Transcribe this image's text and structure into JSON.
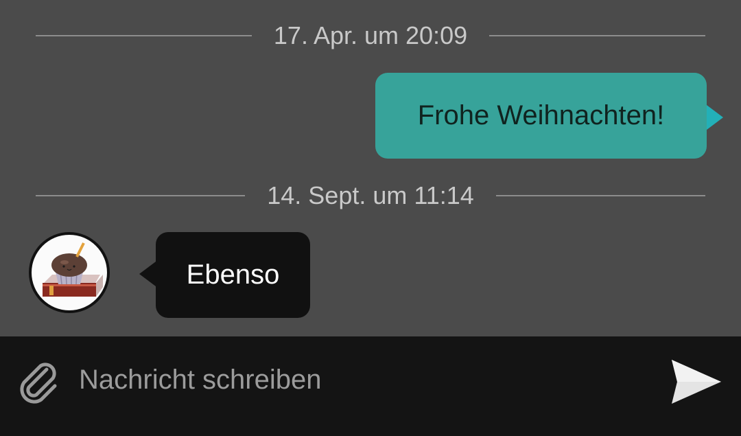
{
  "conversation": {
    "dividers": [
      {
        "label": "17. Apr. um 20:09"
      },
      {
        "label": "14. Sept. um 11:14"
      }
    ],
    "messages": [
      {
        "direction": "outgoing",
        "text": "Frohe Weihnachten!",
        "bubble_color": "#37a39a"
      },
      {
        "direction": "incoming",
        "text": "Ebenso",
        "bubble_color": "#111111"
      }
    ],
    "contact_avatar_icon": "cupcake-on-book-avatar"
  },
  "composer": {
    "attach_icon": "paperclip-icon",
    "placeholder": "Nachricht schreiben",
    "value": "",
    "send_icon": "send-icon"
  },
  "colors": {
    "chat_background": "#4b4b4b",
    "composer_background": "#141414",
    "outgoing_tail": "#23b0b8"
  }
}
